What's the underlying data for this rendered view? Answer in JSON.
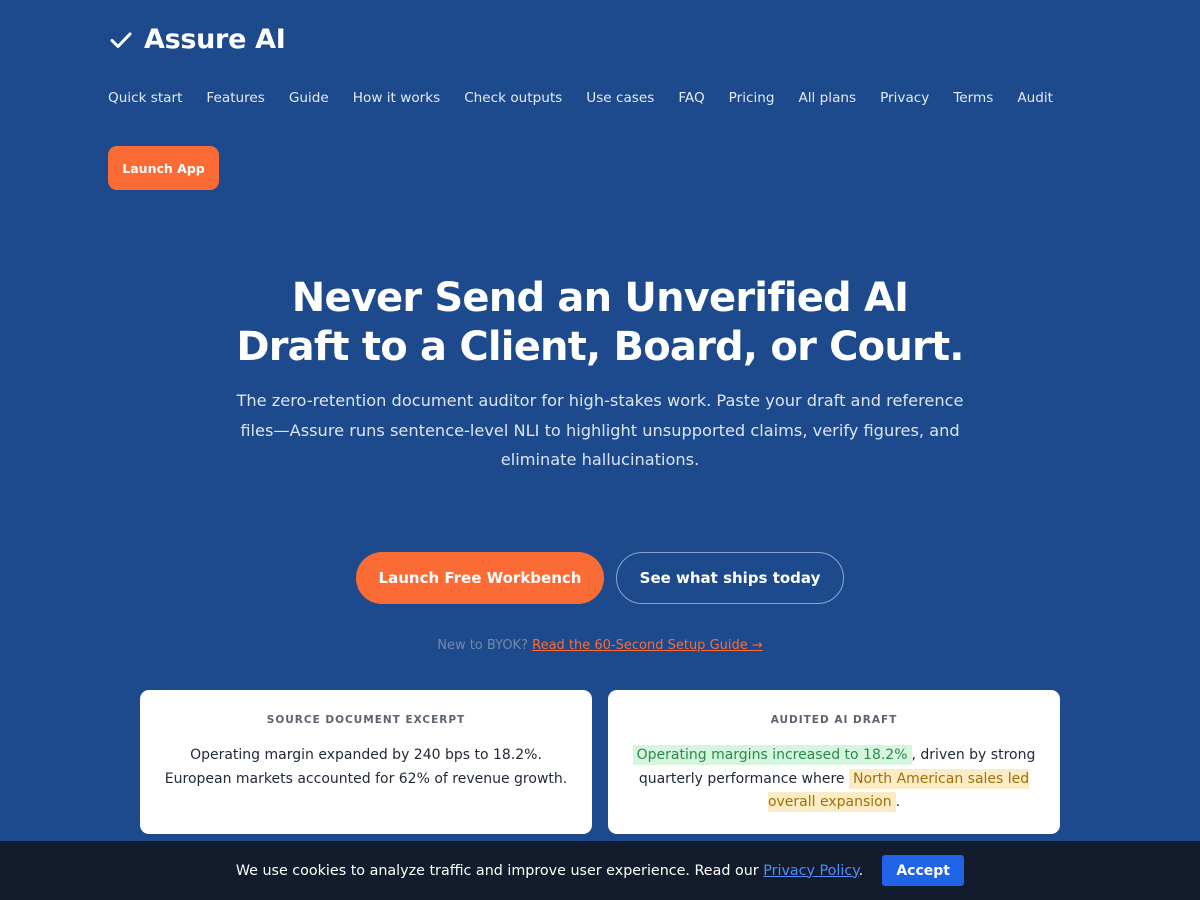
{
  "brand": {
    "icon": "check-icon",
    "name": "Assure AI"
  },
  "nav": {
    "items": [
      {
        "label": "Quick start"
      },
      {
        "label": "Features"
      },
      {
        "label": "Guide"
      },
      {
        "label": "How it works"
      },
      {
        "label": "Check outputs"
      },
      {
        "label": "Use cases"
      },
      {
        "label": "FAQ"
      },
      {
        "label": "Pricing"
      },
      {
        "label": "All plans"
      },
      {
        "label": "Privacy"
      },
      {
        "label": "Terms"
      },
      {
        "label": "Audit"
      }
    ],
    "launch_app_label": "Launch App"
  },
  "hero": {
    "title_line1": "Never Send an Unverified AI",
    "title_line2": "Draft to a Client, Board, or Court.",
    "subtitle": "The zero-retention document auditor for high-stakes work. Paste your draft and reference files—Assure runs sentence-level NLI to highlight unsupported claims, verify figures, and eliminate hallucinations.",
    "cta_primary": "Launch Free Workbench",
    "cta_secondary": "See what ships today",
    "byok_prefix": "New to BYOK?",
    "byok_link": "Read the 60-Second Setup Guide →"
  },
  "cards": {
    "source": {
      "label": "SOURCE DOCUMENT EXCERPT",
      "line1": "Operating margin expanded by 240 bps to 18.2%.",
      "line2": "European markets accounted for 62% of revenue growth."
    },
    "audited": {
      "label": "AUDITED AI DRAFT",
      "supported": "Operating margins increased to 18.2%",
      "text1": ", driven by strong quarterly performance where ",
      "unsupported": "North American sales led overall expansion",
      "text2": "."
    }
  },
  "cookie": {
    "text": "We use cookies to analyze traffic and improve user experience. Read our ",
    "link": "Privacy Policy",
    "suffix": ".",
    "accept": "Accept"
  },
  "colors": {
    "background": "#1d4a8c",
    "accent": "#fb6b35",
    "supported_highlight": "#d5f5df",
    "unsupported_highlight": "#fcecc5",
    "cookie_bar": "#131c2d",
    "accept_button": "#1f63e6"
  }
}
